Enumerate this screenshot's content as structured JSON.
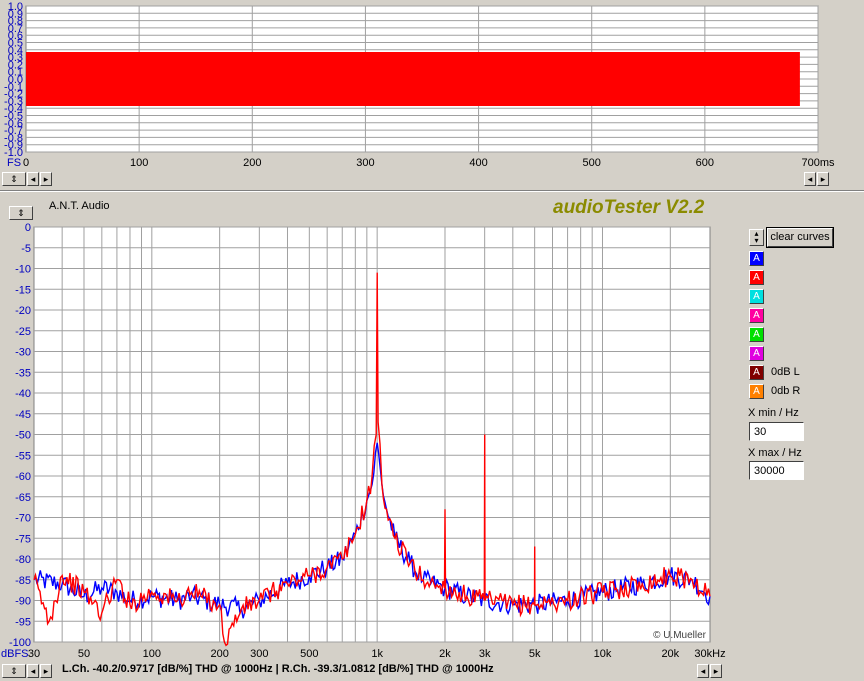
{
  "app_title": "audioTester V2.2",
  "device_label": "A.N.T. Audio",
  "copyright": "© U.Mueller",
  "time_plot": {
    "y_ticks": [
      "1.0",
      "0.9",
      "0.8",
      "0.7",
      "0.6",
      "0.5",
      "0.4",
      "0.3",
      "0.2",
      "0.1",
      "0.0",
      "-0.1",
      "-0.2",
      "-0.3",
      "-0.4",
      "-0.5",
      "-0.6",
      "-0.7",
      "-0.8",
      "-0.9",
      "-1.0"
    ],
    "x_ticks": [
      "0",
      "100",
      "200",
      "300",
      "400",
      "500",
      "600"
    ],
    "x_unit": "700ms",
    "y_unit": "FS",
    "signal_amplitude": 0.37,
    "duration_ms": 684
  },
  "chart_data": {
    "type": "line",
    "xlabel": "",
    "ylabel": "dBFS",
    "x_scale": "log",
    "xlim": [
      30,
      30000
    ],
    "ylim": [
      -100,
      0
    ],
    "y_ticks": [
      "0",
      "-5",
      "-10",
      "-15",
      "-20",
      "-25",
      "-30",
      "-35",
      "-40",
      "-45",
      "-50",
      "-55",
      "-60",
      "-65",
      "-70",
      "-75",
      "-80",
      "-85",
      "-90",
      "-95",
      "-100"
    ],
    "x_ticks": [
      "30",
      "50",
      "100",
      "200",
      "300",
      "500",
      "1k",
      "2k",
      "3k",
      "5k",
      "10k",
      "20k",
      "30kHz"
    ],
    "y_unit": "dBFS",
    "series": [
      {
        "color": "#0000ff",
        "points": [
          [
            30,
            -85
          ],
          [
            40,
            -86
          ],
          [
            50,
            -89
          ],
          [
            60,
            -87
          ],
          [
            70,
            -88
          ],
          [
            80,
            -90
          ],
          [
            100,
            -89
          ],
          [
            130,
            -90
          ],
          [
            150,
            -89
          ],
          [
            200,
            -91
          ],
          [
            250,
            -92
          ],
          [
            300,
            -90
          ],
          [
            400,
            -86
          ],
          [
            500,
            -84
          ],
          [
            600,
            -82
          ],
          [
            700,
            -80
          ],
          [
            800,
            -74
          ],
          [
            900,
            -66
          ],
          [
            950,
            -62
          ],
          [
            1000,
            -52
          ],
          [
            1050,
            -62
          ],
          [
            1100,
            -68
          ],
          [
            1200,
            -75
          ],
          [
            1400,
            -81
          ],
          [
            1600,
            -85
          ],
          [
            2000,
            -87
          ],
          [
            2500,
            -89
          ],
          [
            3000,
            -90
          ],
          [
            4000,
            -91
          ],
          [
            5000,
            -91
          ],
          [
            7000,
            -90
          ],
          [
            10000,
            -88
          ],
          [
            15000,
            -86
          ],
          [
            20000,
            -84
          ],
          [
            25000,
            -85
          ],
          [
            30000,
            -89
          ]
        ]
      },
      {
        "color": "#ff0000",
        "points": [
          [
            30,
            -85
          ],
          [
            35,
            -95
          ],
          [
            40,
            -84
          ],
          [
            50,
            -88
          ],
          [
            60,
            -93
          ],
          [
            70,
            -85
          ],
          [
            80,
            -91
          ],
          [
            100,
            -88
          ],
          [
            130,
            -90
          ],
          [
            150,
            -88
          ],
          [
            200,
            -91
          ],
          [
            210,
            -100
          ],
          [
            250,
            -92
          ],
          [
            300,
            -90
          ],
          [
            400,
            -86
          ],
          [
            500,
            -84
          ],
          [
            600,
            -82
          ],
          [
            700,
            -80
          ],
          [
            800,
            -74
          ],
          [
            900,
            -66
          ],
          [
            950,
            -60
          ],
          [
            990,
            -50
          ],
          [
            1000,
            -11
          ],
          [
            1010,
            -47
          ],
          [
            1050,
            -62
          ],
          [
            1100,
            -68
          ],
          [
            1200,
            -75
          ],
          [
            1400,
            -81
          ],
          [
            1600,
            -85
          ],
          [
            1990,
            -87
          ],
          [
            2000,
            -68
          ],
          [
            2010,
            -87
          ],
          [
            2500,
            -89
          ],
          [
            2990,
            -90
          ],
          [
            3000,
            -50
          ],
          [
            3010,
            -90
          ],
          [
            4000,
            -91
          ],
          [
            4990,
            -91
          ],
          [
            5000,
            -77
          ],
          [
            5010,
            -91
          ],
          [
            7000,
            -90
          ],
          [
            10000,
            -88
          ],
          [
            15000,
            -86
          ],
          [
            20000,
            -84
          ],
          [
            25000,
            -85
          ],
          [
            30000,
            -89
          ]
        ]
      }
    ]
  },
  "channels": [
    {
      "letter": "A",
      "bg": "#0000ff",
      "fg": "#ffffff",
      "label": ""
    },
    {
      "letter": "A",
      "bg": "#ff0000",
      "fg": "#ffffff",
      "label": ""
    },
    {
      "letter": "A",
      "bg": "#00e0e0",
      "fg": "#ffffff",
      "label": ""
    },
    {
      "letter": "A",
      "bg": "#ff00a0",
      "fg": "#ffffff",
      "label": ""
    },
    {
      "letter": "A",
      "bg": "#00e000",
      "fg": "#ffffff",
      "label": ""
    },
    {
      "letter": "A",
      "bg": "#e000e0",
      "fg": "#ffffff",
      "label": ""
    },
    {
      "letter": "A",
      "bg": "#800000",
      "fg": "#ffffff",
      "label": "0dB L"
    },
    {
      "letter": "A",
      "bg": "#ff8000",
      "fg": "#ffffff",
      "label": "0db R"
    }
  ],
  "controls": {
    "clear_label": "clear curves",
    "xmin_label": "X min / Hz",
    "xmin_value": "30",
    "xmax_label": "X max / Hz",
    "xmax_value": "30000"
  },
  "status": "L.Ch. -40.2/0.9717 [dB/%] THD @ 1000Hz  | R.Ch. -39.3/1.0812 [dB/%] THD @ 1000Hz"
}
